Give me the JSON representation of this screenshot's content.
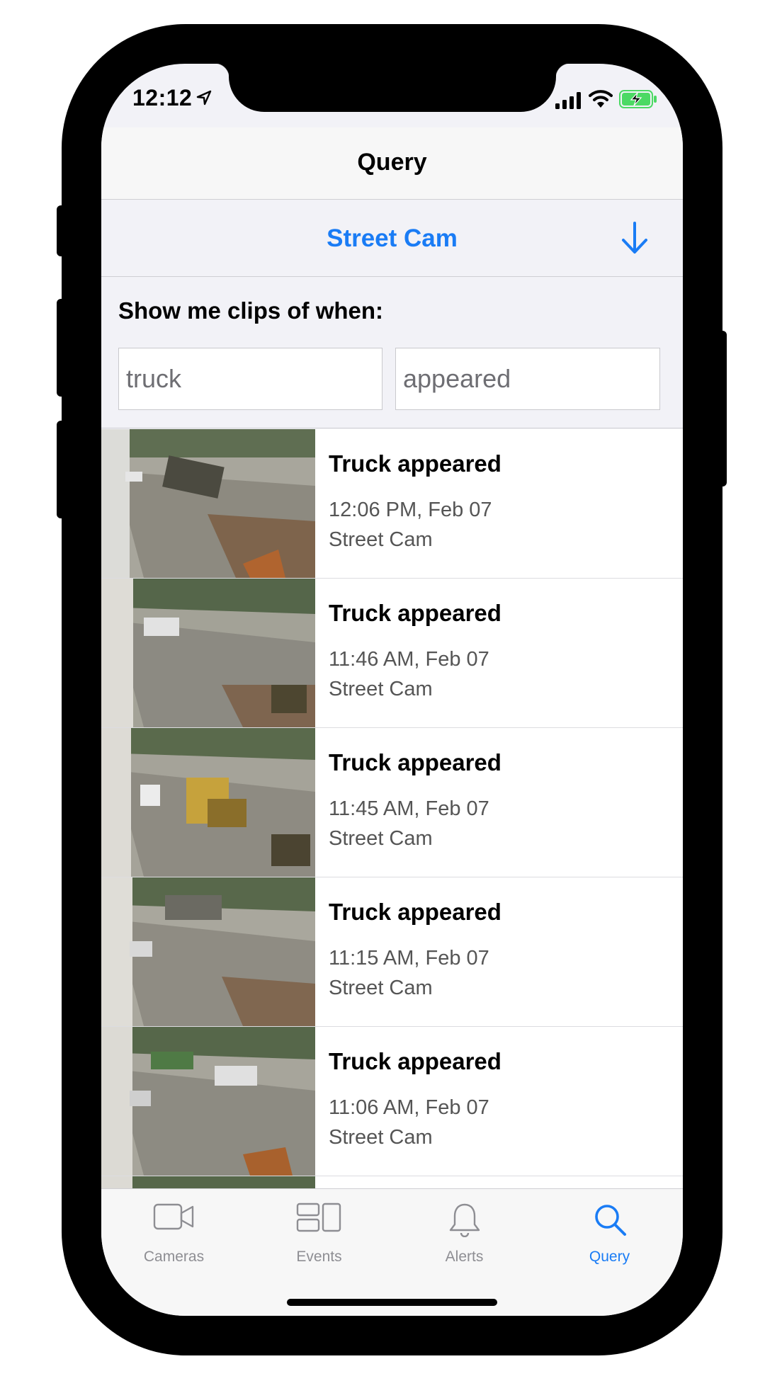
{
  "status_bar": {
    "time": "12:12"
  },
  "nav": {
    "title": "Query"
  },
  "camera_selector": {
    "name": "Street Cam"
  },
  "query": {
    "prompt": "Show me clips of when:",
    "subject": "truck",
    "action": "appeared"
  },
  "results": [
    {
      "title": "Truck appeared",
      "time": "12:06 PM, Feb 07",
      "camera": "Street Cam"
    },
    {
      "title": "Truck appeared",
      "time": "11:46 AM, Feb 07",
      "camera": "Street Cam"
    },
    {
      "title": "Truck appeared",
      "time": "11:45 AM, Feb 07",
      "camera": "Street Cam"
    },
    {
      "title": "Truck appeared",
      "time": "11:15 AM, Feb 07",
      "camera": "Street Cam"
    },
    {
      "title": "Truck appeared",
      "time": "11:06 AM, Feb 07",
      "camera": "Street Cam"
    }
  ],
  "tabs": [
    {
      "label": "Cameras",
      "icon": "video-camera-icon",
      "active": false
    },
    {
      "label": "Events",
      "icon": "events-grid-icon",
      "active": false
    },
    {
      "label": "Alerts",
      "icon": "bell-icon",
      "active": false
    },
    {
      "label": "Query",
      "icon": "magnifying-glass-icon",
      "active": true
    }
  ],
  "colors": {
    "accent": "#1a7cf5",
    "battery": "#4cd964"
  }
}
